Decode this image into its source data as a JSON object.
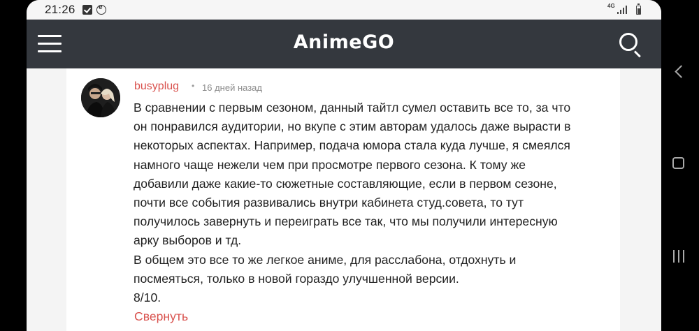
{
  "status_bar": {
    "time": "21:26",
    "network": "4G",
    "icons": [
      "check-icon",
      "e-icon",
      "signal-icon",
      "battery-icon"
    ]
  },
  "header": {
    "title": "AnimeGO",
    "menu_icon": "hamburger-menu-icon",
    "search_icon": "search-icon"
  },
  "comment": {
    "author": "busyplug",
    "separator": "•",
    "time": "16 дней назад",
    "lines": [
      "В сравнении с первым сезоном, данный тайтл сумел оставить все то, за что",
      "он понравился аудитории, но вкупе с этим авторам удалось даже вырасти в",
      "некоторых аспектах. Например, подача юмора стала куда лучше, я смеялся",
      "намного чаще нежели чем при просмотре первого сезона. К тому же",
      "добавили даже какие-то сюжетные составляющие, если в первом сезоне,",
      "почти все события развивались внутри кабинета студ.совета, то тут",
      "получилось завернуть и переиграть все так, что мы получили интересную",
      "арку выборов и тд.",
      "В общем это все то же легкое аниме, для расслабона, отдохнуть и",
      "посмеяться, только в новой гораздо улучшенной версии.",
      "8/10."
    ],
    "collapse_label": "Свернуть"
  },
  "nav_bar": {
    "icons": [
      "back-icon",
      "home-icon",
      "recents-icon"
    ]
  },
  "colors": {
    "header_bg": "#34383e",
    "accent": "#d9534f",
    "page_bg": "#f4f4f4"
  }
}
